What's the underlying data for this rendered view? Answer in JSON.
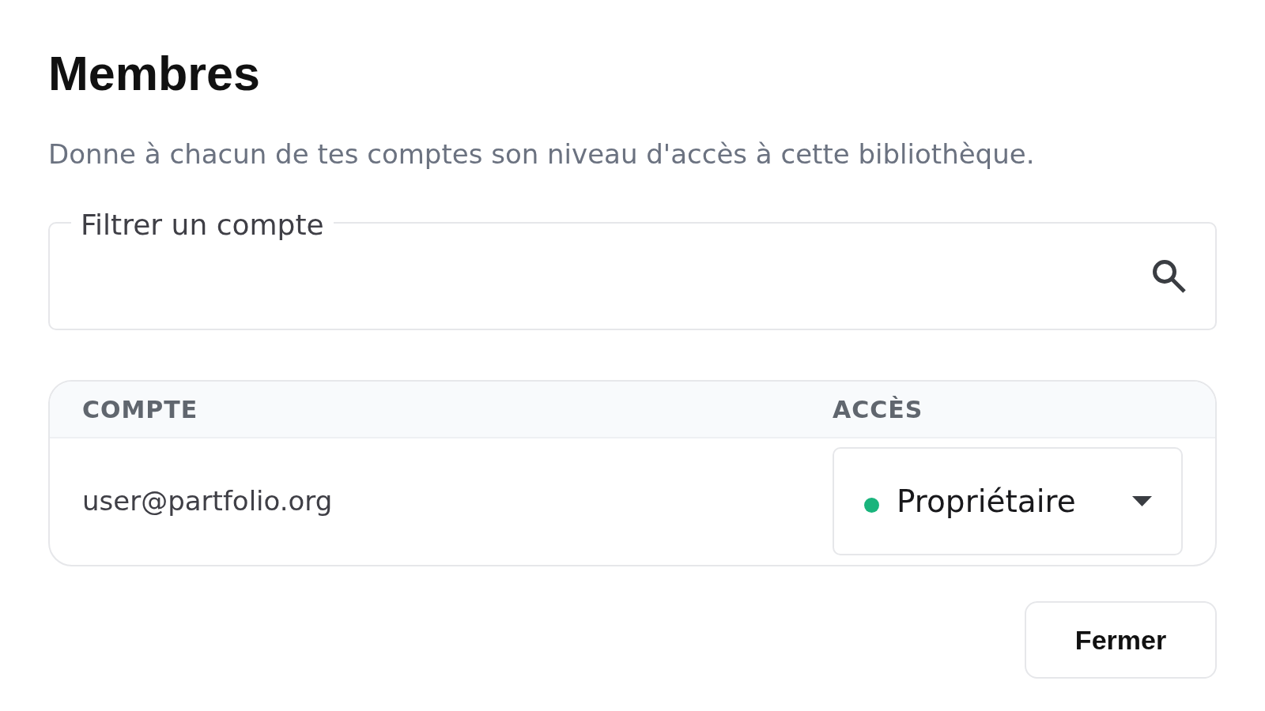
{
  "dialog": {
    "title": "Membres",
    "description": "Donne à chacun de tes comptes son niveau d'accès à cette bibliothèque.",
    "filter": {
      "label": "Filtrer un compte"
    },
    "table": {
      "columns": [
        "COMPTE",
        "ACCÈS"
      ],
      "rows": [
        {
          "account": "user@partfolio.org",
          "access": "Propriétaire",
          "color": "#19b47c"
        }
      ]
    },
    "buttons": [
      "Fermer"
    ]
  }
}
